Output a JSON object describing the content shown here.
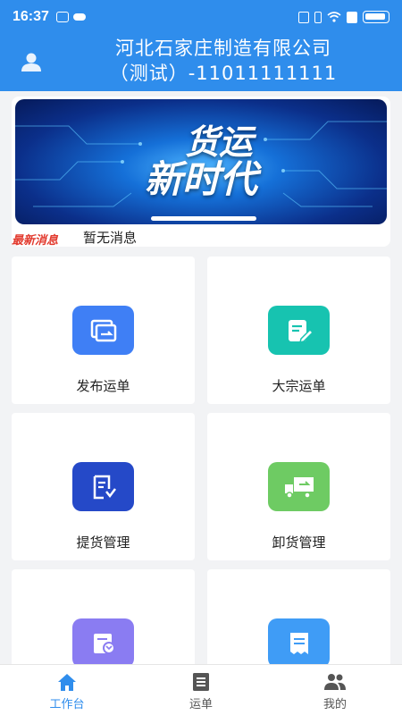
{
  "status_bar": {
    "time": "16:37"
  },
  "header": {
    "company_line1": "河北石家庄制造有限公司",
    "company_line2": "（测试）-11011111111"
  },
  "banner": {
    "line1": "货运",
    "line2": "新时代"
  },
  "news": {
    "label": "最新消息",
    "text": "暂无消息"
  },
  "tiles": [
    {
      "label": "发布运单",
      "icon": "publish-waybill-icon",
      "color": "#3f7ff5"
    },
    {
      "label": "大宗运单",
      "icon": "bulk-waybill-icon",
      "color": "#17c3b0"
    },
    {
      "label": "提货管理",
      "icon": "pickup-management-icon",
      "color": "#2549c8"
    },
    {
      "label": "卸货管理",
      "icon": "unload-management-icon",
      "color": "#6ecb63"
    },
    {
      "label": "",
      "icon": "settlement-icon",
      "color": "#8a7cf2"
    },
    {
      "label": "",
      "icon": "receipt-icon",
      "color": "#3f9cf6"
    }
  ],
  "tabbar": {
    "tabs": [
      {
        "label": "工作台",
        "icon": "home-icon",
        "active": true
      },
      {
        "label": "运单",
        "icon": "waybill-icon",
        "active": false
      },
      {
        "label": "我的",
        "icon": "profile-icon",
        "active": false
      }
    ]
  },
  "colors": {
    "primary": "#2f8dec",
    "news_label": "#e23a2e"
  }
}
